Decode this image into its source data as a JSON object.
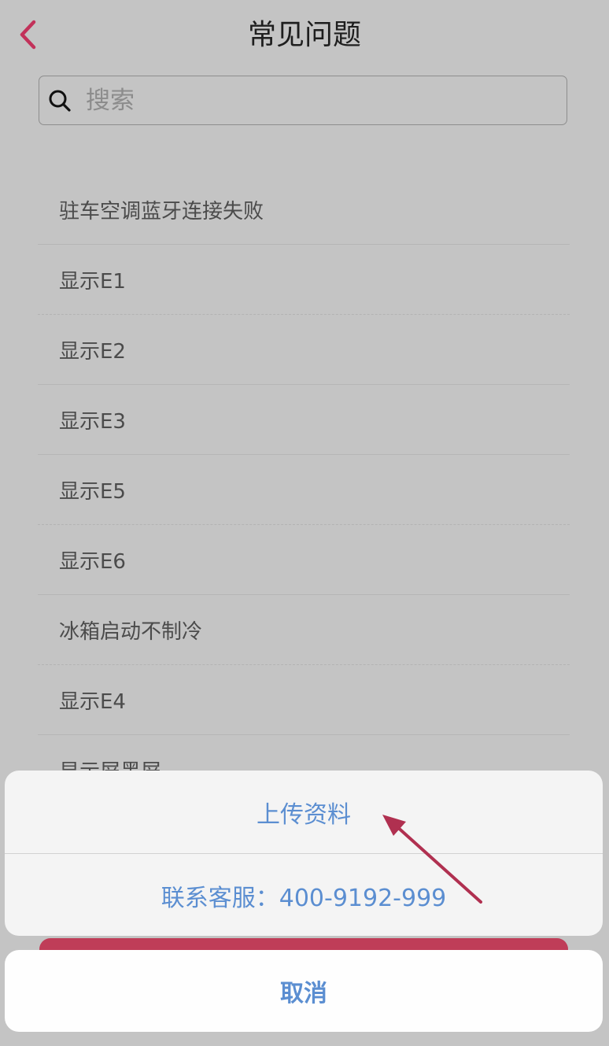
{
  "header": {
    "title": "常见问题",
    "back_icon": "chevron-left-icon",
    "accent_color": "#c2325a"
  },
  "search": {
    "placeholder": "搜索",
    "value": "",
    "icon": "search-icon"
  },
  "faq_items": [
    {
      "label": "驻车空调蓝牙连接失败"
    },
    {
      "label": "显示E1"
    },
    {
      "label": "显示E2"
    },
    {
      "label": "显示E3"
    },
    {
      "label": "显示E5"
    },
    {
      "label": "显示E6"
    },
    {
      "label": "冰箱启动不制冷"
    },
    {
      "label": "显示E4"
    },
    {
      "label": "显示屏黑屏"
    }
  ],
  "action_sheet": {
    "upload_label": "上传资料",
    "contact_label": "联系客服：400-9192-999",
    "cancel_label": "取消",
    "text_color": "#5b8ed1"
  },
  "annotation": {
    "arrow_icon": "arrow-annotation-icon",
    "color": "#b03050"
  }
}
